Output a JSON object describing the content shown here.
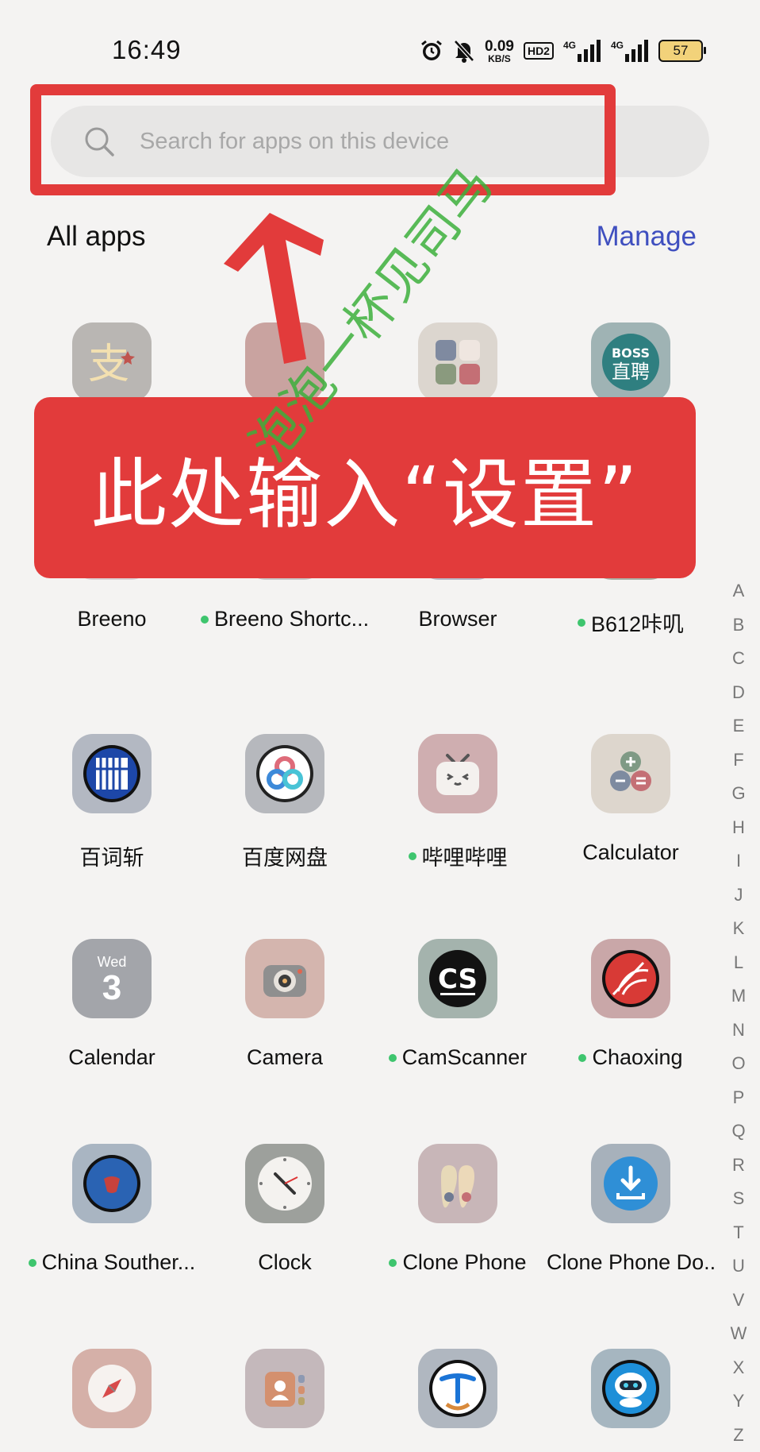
{
  "status_bar": {
    "time": "16:49",
    "net_speed": "0.09",
    "net_speed_unit": "KB/S",
    "hd_badge": "HD2",
    "signal1_label": "4G",
    "signal2_label": "4G",
    "battery": "57"
  },
  "search": {
    "placeholder": "Search for apps on this device"
  },
  "header": {
    "title": "All apps",
    "manage": "Manage"
  },
  "apps": [
    {
      "label": "",
      "icon": "alipay-icon",
      "dot": false
    },
    {
      "label": "",
      "icon": "app-icon",
      "dot": false
    },
    {
      "label": "",
      "icon": "folder-grid-icon",
      "dot": false
    },
    {
      "label": "",
      "icon": "boss-zhipin-icon",
      "dot": false
    },
    {
      "label": "Breeno",
      "icon": "breeno-icon",
      "dot": false
    },
    {
      "label": "Breeno Shortc...",
      "icon": "breeno-shortcuts-icon",
      "dot": true
    },
    {
      "label": "Browser",
      "icon": "browser-icon",
      "dot": false
    },
    {
      "label": "B612咔叽",
      "icon": "b612-icon",
      "dot": true
    },
    {
      "label": "百词斩",
      "icon": "baicizhan-icon",
      "dot": false
    },
    {
      "label": "百度网盘",
      "icon": "baidu-netdisk-icon",
      "dot": false
    },
    {
      "label": "哔哩哔哩",
      "icon": "bilibili-icon",
      "dot": true
    },
    {
      "label": "Calculator",
      "icon": "calculator-icon",
      "dot": false
    },
    {
      "label": "Calendar",
      "icon": "calendar-icon",
      "dot": false,
      "day": "Wed",
      "date": "3"
    },
    {
      "label": "Camera",
      "icon": "camera-icon",
      "dot": false
    },
    {
      "label": "CamScanner",
      "icon": "camscanner-icon",
      "dot": true
    },
    {
      "label": "Chaoxing",
      "icon": "chaoxing-icon",
      "dot": true
    },
    {
      "label": "China Souther...",
      "icon": "china-southern-icon",
      "dot": true
    },
    {
      "label": "Clock",
      "icon": "clock-icon",
      "dot": false
    },
    {
      "label": "Clone Phone",
      "icon": "clone-phone-icon",
      "dot": true
    },
    {
      "label": "Clone Phone Do...",
      "icon": "clone-phone-download-icon",
      "dot": false
    },
    {
      "label": "",
      "icon": "compass-icon",
      "dot": false
    },
    {
      "label": "",
      "icon": "contacts-icon",
      "dot": false
    },
    {
      "label": "",
      "icon": "china-telecom-icon",
      "dot": false
    },
    {
      "label": "",
      "icon": "robot-app-icon",
      "dot": false
    }
  ],
  "index_letters": [
    "A",
    "B",
    "C",
    "D",
    "E",
    "F",
    "G",
    "H",
    "I",
    "J",
    "K",
    "L",
    "M",
    "N",
    "O",
    "P",
    "Q",
    "R",
    "S",
    "T",
    "U",
    "V",
    "W",
    "X",
    "Y",
    "Z"
  ],
  "overlay": {
    "banner_text": "此处输入“设置”",
    "watermark": "泡泡一杯见司马"
  },
  "colors": {
    "accent": "#3f4fbf",
    "highlight_red": "#e23b3b",
    "badge_dot": "#3ec56e",
    "background": "#f4f3f2"
  }
}
